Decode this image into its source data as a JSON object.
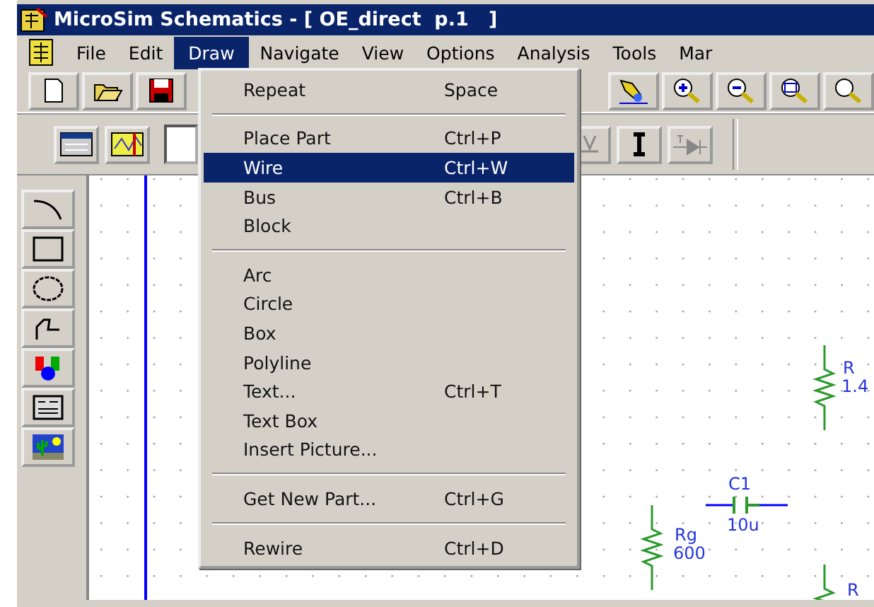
{
  "window": {
    "title": "MicroSim Schematics - [ OE_direct  p.1   ]"
  },
  "menu_bar": [
    {
      "label": "File",
      "selected": false
    },
    {
      "label": "Edit",
      "selected": false
    },
    {
      "label": "Draw",
      "selected": true
    },
    {
      "label": "Navigate",
      "selected": false
    },
    {
      "label": "View",
      "selected": false
    },
    {
      "label": "Options",
      "selected": false
    },
    {
      "label": "Analysis",
      "selected": false
    },
    {
      "label": "Tools",
      "selected": false
    },
    {
      "label": "Mar",
      "selected": false
    }
  ],
  "draw_menu": {
    "items": [
      {
        "kind": "item",
        "label": "Repeat",
        "shortcut": "Space",
        "selected": false
      },
      {
        "kind": "separator"
      },
      {
        "kind": "item",
        "label": "Place Part",
        "shortcut": "Ctrl+P",
        "selected": false
      },
      {
        "kind": "item",
        "label": "Wire",
        "shortcut": "Ctrl+W",
        "selected": true
      },
      {
        "kind": "item",
        "label": "Bus",
        "shortcut": "Ctrl+B",
        "selected": false
      },
      {
        "kind": "item",
        "label": "Block",
        "selected": false
      },
      {
        "kind": "separator"
      },
      {
        "kind": "item",
        "label": "Arc",
        "selected": false
      },
      {
        "kind": "item",
        "label": "Circle",
        "selected": false
      },
      {
        "kind": "item",
        "label": "Box",
        "selected": false
      },
      {
        "kind": "item",
        "label": "Polyline",
        "selected": false
      },
      {
        "kind": "item",
        "label": "Text...",
        "shortcut": "Ctrl+T",
        "selected": false
      },
      {
        "kind": "item",
        "label": "Text Box",
        "selected": false
      },
      {
        "kind": "item",
        "label": "Insert Picture...",
        "selected": false
      },
      {
        "kind": "separator"
      },
      {
        "kind": "item",
        "label": "Get New Part...",
        "shortcut": "Ctrl+G",
        "selected": false
      },
      {
        "kind": "separator"
      },
      {
        "kind": "item",
        "label": "Rewire",
        "shortcut": "Ctrl+D",
        "selected": false
      }
    ]
  },
  "schematic": {
    "parts": [
      {
        "kind": "resistor",
        "label": "R",
        "value": "1.4"
      },
      {
        "kind": "capacitor",
        "label": "C1",
        "value": "10u"
      },
      {
        "kind": "resistor",
        "label": "Rg",
        "value": "600"
      },
      {
        "kind": "resistor",
        "label": "R"
      }
    ]
  }
}
